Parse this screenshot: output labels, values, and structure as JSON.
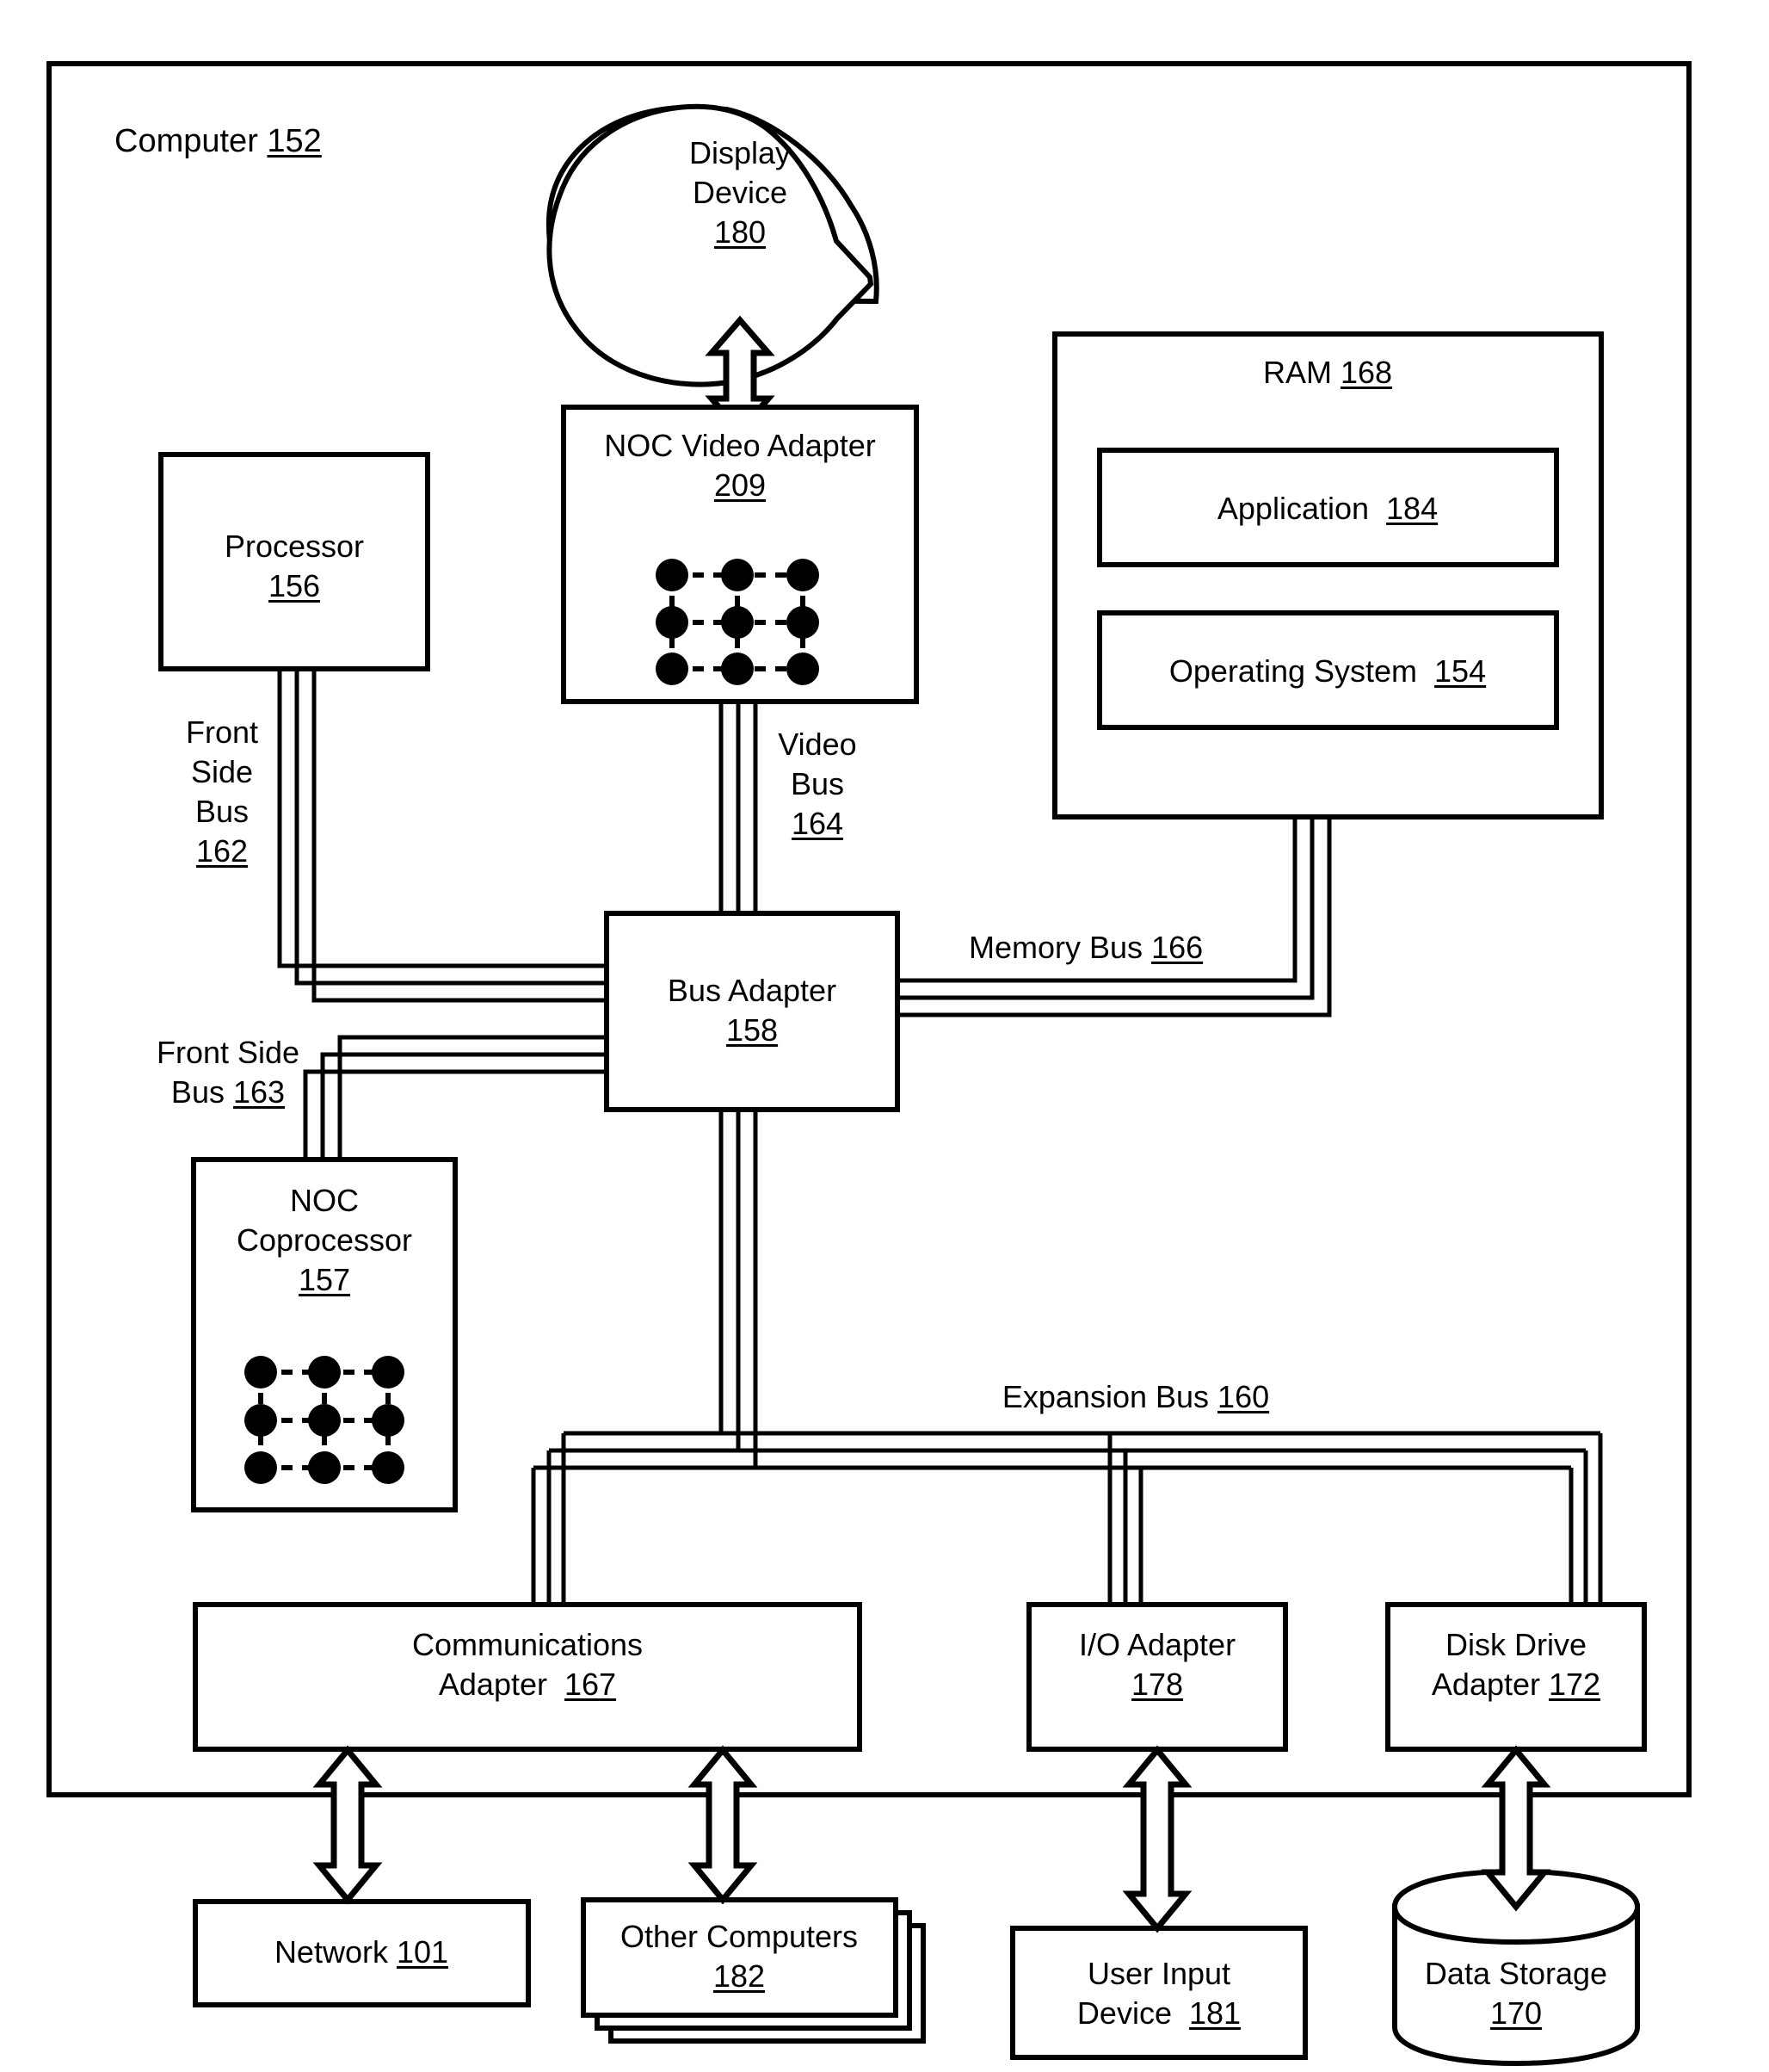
{
  "diagram": {
    "outer": {
      "title": "Computer",
      "ref": "152"
    },
    "nodes": {
      "display_device": {
        "line1": "Display",
        "line2": "Device",
        "ref": "180"
      },
      "noc_video_adapter": {
        "title": "NOC Video Adapter",
        "ref": "209"
      },
      "ram": {
        "title": "RAM",
        "ref": "168"
      },
      "application": {
        "title": "Application",
        "ref": "184"
      },
      "operating_system": {
        "title": "Operating System",
        "ref": "154"
      },
      "processor": {
        "title": "Processor",
        "ref": "156"
      },
      "bus_adapter": {
        "title": "Bus Adapter",
        "ref": "158"
      },
      "noc_coprocessor": {
        "line1": "NOC",
        "line2": "Coprocessor",
        "ref": "157"
      },
      "communications_adapter": {
        "line1": "Communications",
        "line2": "Adapter",
        "ref": "167"
      },
      "io_adapter": {
        "title": "I/O Adapter",
        "ref": "178"
      },
      "disk_drive_adapter": {
        "line1": "Disk Drive",
        "line2": "Adapter",
        "ref": "172"
      },
      "network": {
        "title": "Network",
        "ref": "101"
      },
      "other_computers": {
        "title": "Other Computers",
        "ref": "182"
      },
      "user_input_device": {
        "line1": "User Input",
        "line2": "Device",
        "ref": "181"
      },
      "data_storage": {
        "title": "Data Storage",
        "ref": "170"
      }
    },
    "buses": {
      "front_side_bus_162": {
        "line1": "Front",
        "line2": "Side",
        "line3": "Bus",
        "ref": "162"
      },
      "video_bus_164": {
        "line1": "Video",
        "line2": "Bus",
        "ref": "164"
      },
      "memory_bus_166": {
        "title": "Memory Bus",
        "ref": "166"
      },
      "front_side_bus_163": {
        "line1": "Front Side",
        "line2": "Bus",
        "ref": "163"
      },
      "expansion_bus_160": {
        "title": "Expansion Bus",
        "ref": "160"
      }
    },
    "colors": {
      "ink": "#000000",
      "paper": "#ffffff"
    }
  }
}
